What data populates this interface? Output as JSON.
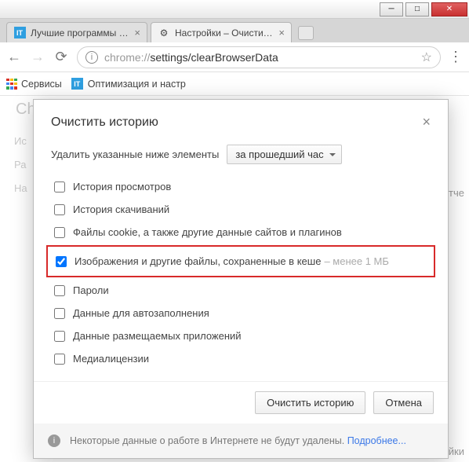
{
  "window": {
    "tabs": [
      {
        "label": "Лучшие программы для",
        "favicon": "IT"
      },
      {
        "label": "Настройки – Очистить и",
        "favicon": "gear"
      }
    ],
    "active_tab": 1
  },
  "toolbar": {
    "url_protocol": "chrome://",
    "url_path": "settings/clearBrowserData"
  },
  "bookmarks": {
    "apps_label": "Сервисы",
    "items": [
      {
        "label": "Оптимизация и настр",
        "favicon": "IT"
      }
    ]
  },
  "background": {
    "title_cut": "Ch",
    "row1": "Ис",
    "row2": "Ра",
    "row3": "На",
    "right1": "и отче",
    "right2": "тройки"
  },
  "dialog": {
    "title": "Очистить историю",
    "intro": "Удалить указанные ниже элементы",
    "timerange": "за прошедший час",
    "items": [
      {
        "label": "История просмотров",
        "checked": false
      },
      {
        "label": "История скачиваний",
        "checked": false
      },
      {
        "label": "Файлы cookie, а также другие данные сайтов и плагинов",
        "checked": false
      },
      {
        "label": "Изображения и другие файлы, сохраненные в кеше",
        "suffix": "– менее 1 МБ",
        "checked": true,
        "highlighted": true
      },
      {
        "label": "Пароли",
        "checked": false
      },
      {
        "label": "Данные для автозаполнения",
        "checked": false
      },
      {
        "label": "Данные размещаемых приложений",
        "checked": false
      },
      {
        "label": "Медиалицензии",
        "checked": false
      }
    ],
    "confirm": "Очистить историю",
    "cancel": "Отмена",
    "note_text": "Некоторые данные о работе в Интернете не будут удалены. ",
    "note_link": "Подробнее..."
  }
}
